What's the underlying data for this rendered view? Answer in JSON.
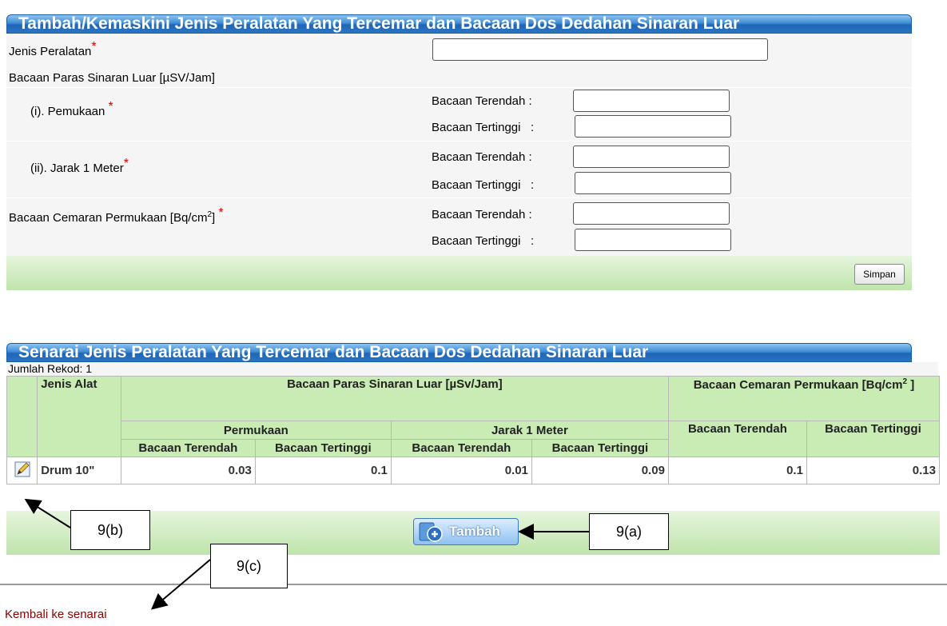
{
  "form": {
    "title": "Tambah/Kemaskini Jenis Peralatan Yang Tercemar dan Bacaan Dos Dedahan Sinaran Luar",
    "jenis_peralatan_label": "Jenis Peralatan",
    "required_mark": "*",
    "bacaan_paras_label": "Bacaan Paras Sinaran Luar [µSV/Jam]",
    "pemukaan_label": "(i). Pemukaan",
    "jarak_label": "(ii). Jarak 1 Meter",
    "cemaran_label_prefix": "Bacaan Cemaran Permukaan [Bq/cm",
    "cemaran_label_sup": "2",
    "cemaran_label_suffix": "]",
    "terendah_label": "Bacaan Terendah :",
    "tertinggi_label": "Bacaan Tertinggi   :",
    "save_label": "Simpan"
  },
  "list": {
    "title": "Senarai Jenis Peralatan Yang Tercemar dan Bacaan Dos Dedahan Sinaran Luar",
    "record_count": "Jumlah Rekod: 1",
    "headers": {
      "jenis_alat": "Jenis Alat",
      "bacaan_paras": "Bacaan Paras Sinaran Luar [µSv/Jam]",
      "cemaran_prefix": "Bacaan Cemaran Permukaan [Bq/cm",
      "cemaran_sup": "2",
      "cemaran_suffix": " ]",
      "permukaan": "Permukaan",
      "jarak": "Jarak 1 Meter",
      "terendah": "Bacaan Terendah",
      "tertinggi": "Bacaan Tertinggi"
    },
    "rows": [
      {
        "jenis": "Drum 10\"",
        "p_low": "0.03",
        "p_high": "0.1",
        "j_low": "0.01",
        "j_high": "0.09",
        "c_low": "0.1",
        "c_high": "0.13"
      }
    ],
    "add_label": "Tambah"
  },
  "back_link": "Kembali ke senarai",
  "callouts": {
    "a": "9(a)",
    "b": "9(b)",
    "c": "9(c)"
  }
}
